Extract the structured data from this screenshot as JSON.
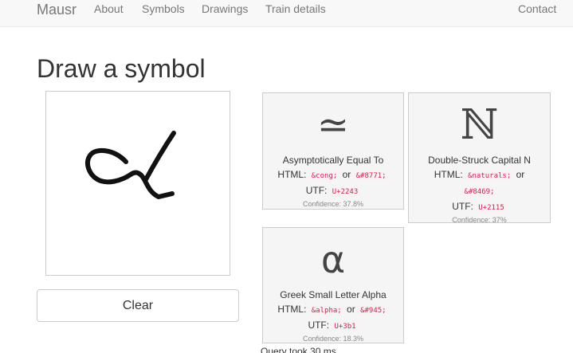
{
  "nav": {
    "brand": "Mausr",
    "about": "About",
    "symbols": "Symbols",
    "drawings": "Drawings",
    "train": "Train details",
    "contact": "Contact"
  },
  "page": {
    "title": "Draw a symbol",
    "clear_label": "Clear",
    "query_time": "Query took 30 ms"
  },
  "results": [
    {
      "glyph": "≃",
      "name": "Asymptotically Equal To",
      "html_label": "HTML:",
      "html_entity": "&cong;",
      "or": "or",
      "html_code": "&#8771;",
      "utf_label": "UTF:",
      "utf": "U+2243",
      "confidence": "Confidence: 37.8%"
    },
    {
      "glyph": "ℕ",
      "name": "Double-Struck Capital N",
      "html_label": "HTML:",
      "html_entity": "&naturals;",
      "or": "or",
      "html_code": "&#8469;",
      "utf_label": "UTF:",
      "utf": "U+2115",
      "confidence": "Confidence: 37%"
    },
    {
      "glyph": "α",
      "name": "Greek Small Letter Alpha",
      "html_label": "HTML:",
      "html_entity": "&alpha;",
      "or": "or",
      "html_code": "&#945;",
      "utf_label": "UTF:",
      "utf": "U+3b1",
      "confidence": "Confidence: 18.3%"
    }
  ]
}
